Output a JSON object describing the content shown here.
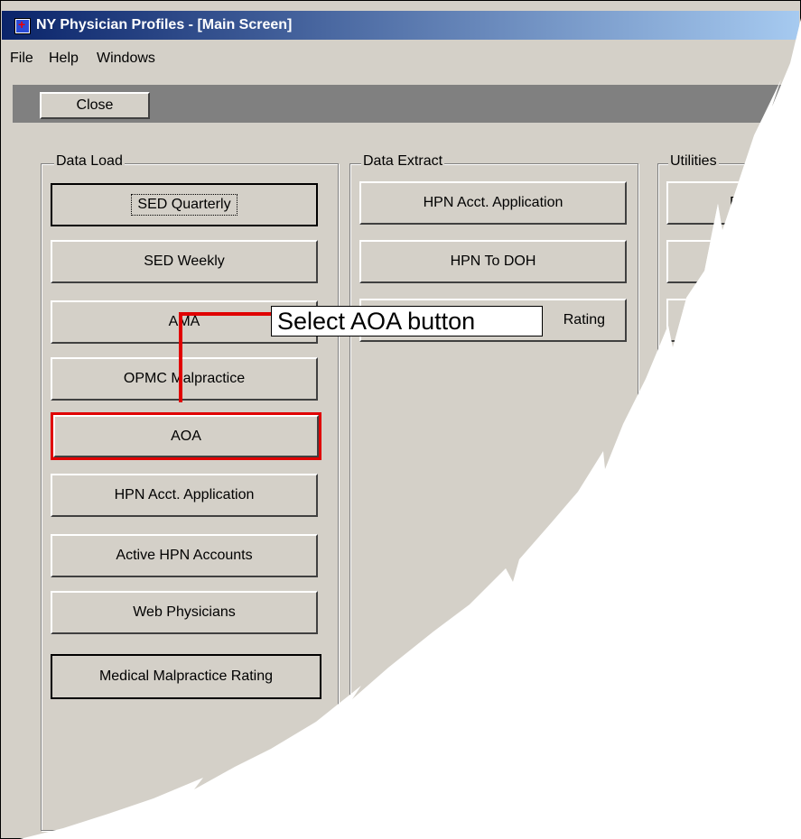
{
  "window": {
    "title": "NY Physician Profiles - [Main Screen]"
  },
  "menu": {
    "items": [
      "File",
      "Help",
      "Windows"
    ]
  },
  "toolbar": {
    "close_label": "Close"
  },
  "groups": {
    "data_load": {
      "label": "Data Load",
      "buttons": [
        "SED Quarterly",
        "SED Weekly",
        "AMA",
        "OPMC Malpractice",
        "AOA",
        "HPN Acct. Application",
        "Active HPN Accounts",
        "Web Physicians",
        "Medical Malpractice Rating"
      ]
    },
    "data_extract": {
      "label": "Data Extract",
      "buttons": [
        "HPN Acct. Application",
        "HPN To DOH",
        "Rating"
      ]
    },
    "utilities": {
      "label": "Utilities",
      "buttons": [
        "R"
      ]
    }
  },
  "annotation": {
    "callout_text": "Select AOA button",
    "highlight_color": "#e00000"
  }
}
